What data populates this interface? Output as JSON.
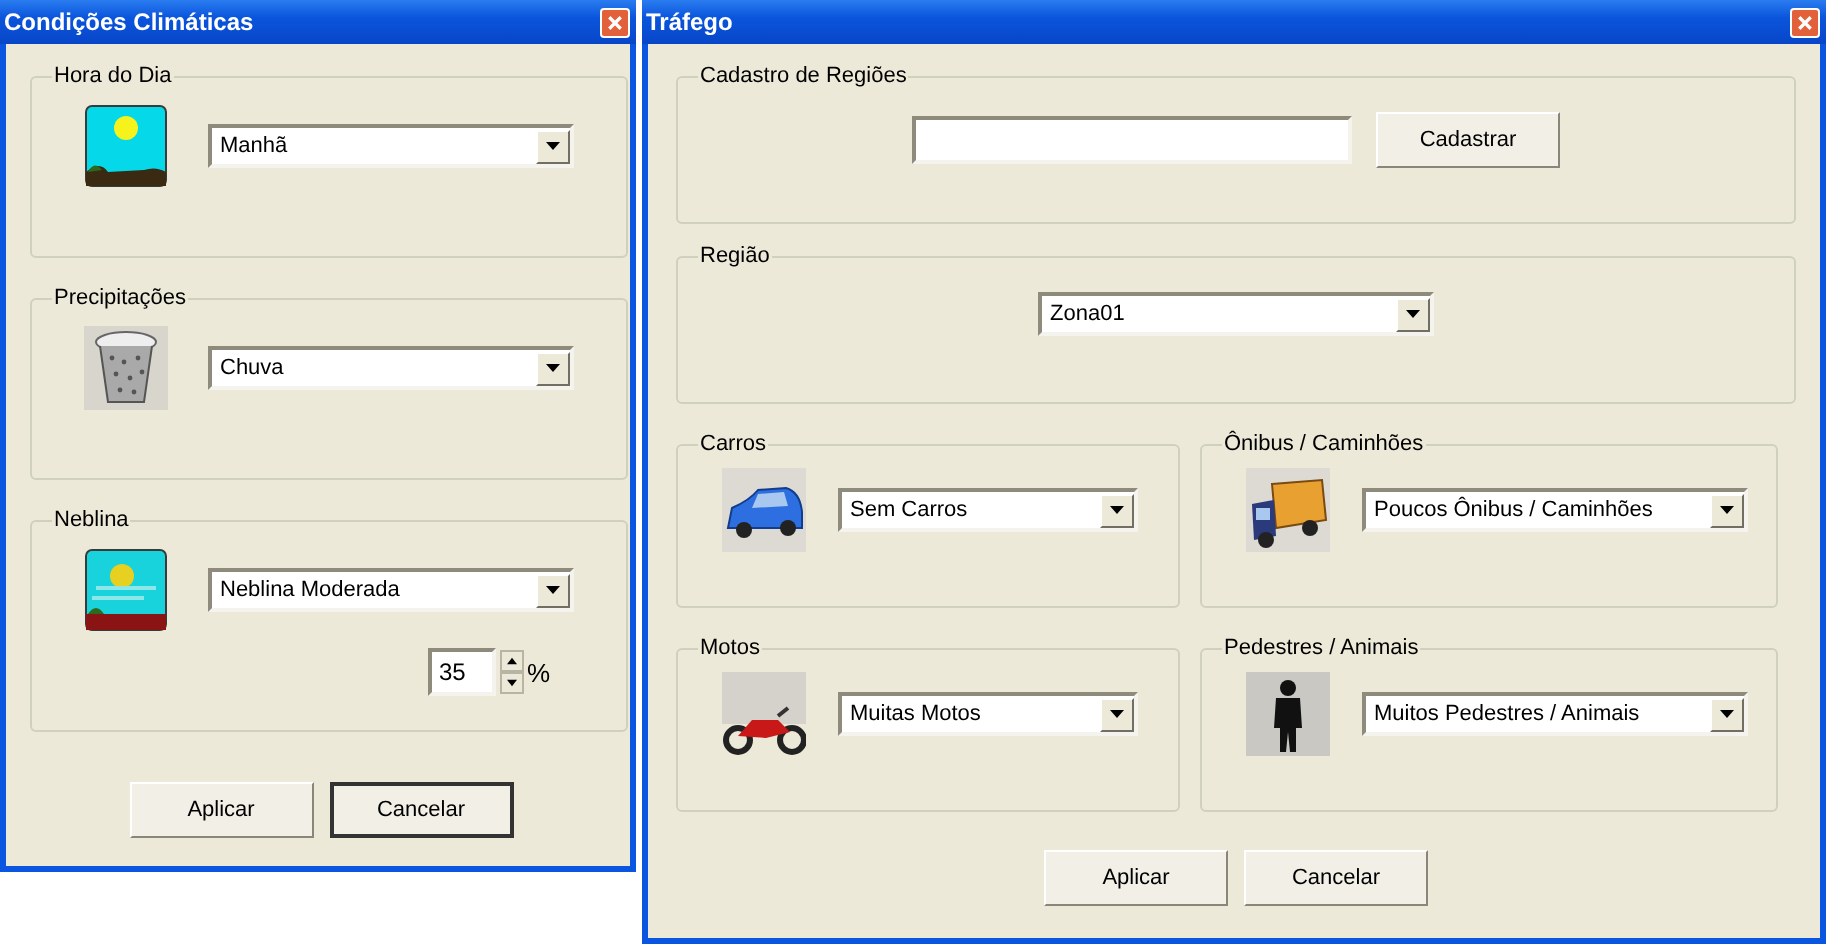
{
  "climate_window": {
    "title": "Condições Climáticas",
    "groups": [
      {
        "kind": "daytime",
        "label": "Hora do Dia",
        "value": "Manhã"
      },
      {
        "kind": "rain",
        "label": "Precipitações",
        "value": "Chuva"
      },
      {
        "kind": "fog",
        "label": "Neblina",
        "value": "Neblina Moderada",
        "spinner": {
          "value": "35",
          "unit": "%"
        }
      }
    ],
    "buttons": [
      {
        "label": "Aplicar",
        "focused": false
      },
      {
        "label": "Cancelar",
        "focused": true
      }
    ]
  },
  "traffic_window": {
    "title": "Tráfego",
    "register": {
      "label": "Cadastro de Regiões",
      "button": "Cadastrar"
    },
    "region": {
      "label": "Região",
      "value": "Zona01"
    },
    "categories": [
      {
        "kind": "car",
        "label": "Carros",
        "value": "Sem Carros"
      },
      {
        "kind": "truck",
        "label": "Ônibus / Caminhões",
        "value": "Poucos Ônibus / Caminhões"
      },
      {
        "kind": "motorcycle",
        "label": "Motos",
        "value": "Muitas Motos"
      },
      {
        "kind": "pedestrian",
        "label": "Pedestres / Animais",
        "value": "Muitos Pedestres / Animais"
      }
    ],
    "buttons": [
      {
        "label": "Aplicar",
        "focused": false
      },
      {
        "label": "Cancelar",
        "focused": false
      }
    ]
  }
}
